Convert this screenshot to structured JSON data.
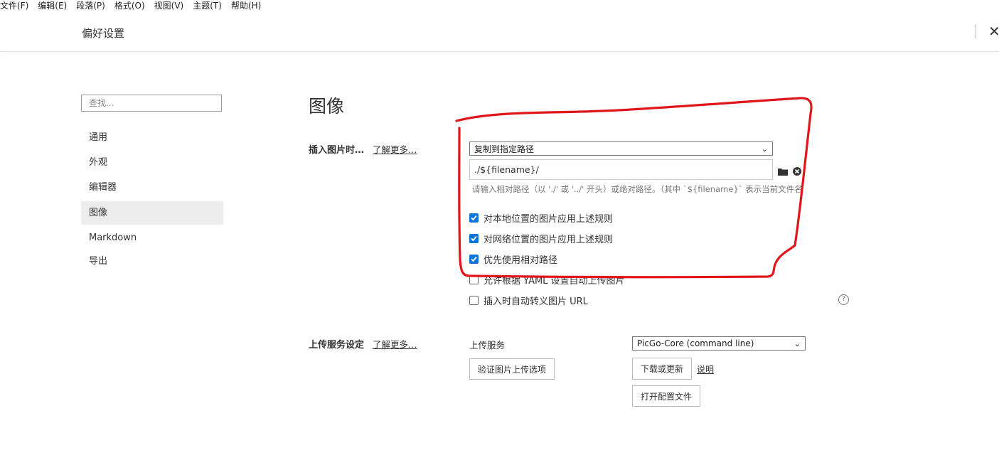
{
  "menubar": {
    "items": [
      "文件(F)",
      "编辑(E)",
      "段落(P)",
      "格式(O)",
      "视图(V)",
      "主题(T)",
      "帮助(H)"
    ]
  },
  "header": {
    "title": "偏好设置",
    "close_icon": "close-icon"
  },
  "sidebar": {
    "search_placeholder": "查找...",
    "items": [
      {
        "label": "通用"
      },
      {
        "label": "外观"
      },
      {
        "label": "编辑器"
      },
      {
        "label": "图像",
        "active": true
      },
      {
        "label": "Markdown"
      },
      {
        "label": "导出"
      }
    ]
  },
  "main": {
    "section_title": "图像",
    "insert": {
      "label": "插入图片时…",
      "learn_more": "了解更多…",
      "select_value": "复制到指定路径",
      "path_value": "./${filename}/",
      "hint": "请输入相对路径（以 './' 或 '../' 开头）或绝对路径。（其中 `${filename}` 表示当前文件名",
      "checkboxes": [
        {
          "label": "对本地位置的图片应用上述规则",
          "checked": true
        },
        {
          "label": "对网络位置的图片应用上述规则",
          "checked": true
        },
        {
          "label": "优先使用相对路径",
          "checked": true
        },
        {
          "label": "允许根据 YAML 设置自动上传图片",
          "checked": false
        },
        {
          "label": "插入时自动转义图片 URL",
          "checked": false
        }
      ],
      "help_icon": "?"
    },
    "upload": {
      "label": "上传服务设定",
      "learn_more": "了解更多…",
      "service_label": "上传服务",
      "service_value": "PicGo-Core (command line)",
      "verify_button": "验证图片上传选项",
      "download_button": "下载或更新",
      "explain_link": "说明",
      "open_config_button": "打开配置文件"
    }
  },
  "colors": {
    "checkbox": "#0a74da",
    "annotation": "#e0161b"
  }
}
